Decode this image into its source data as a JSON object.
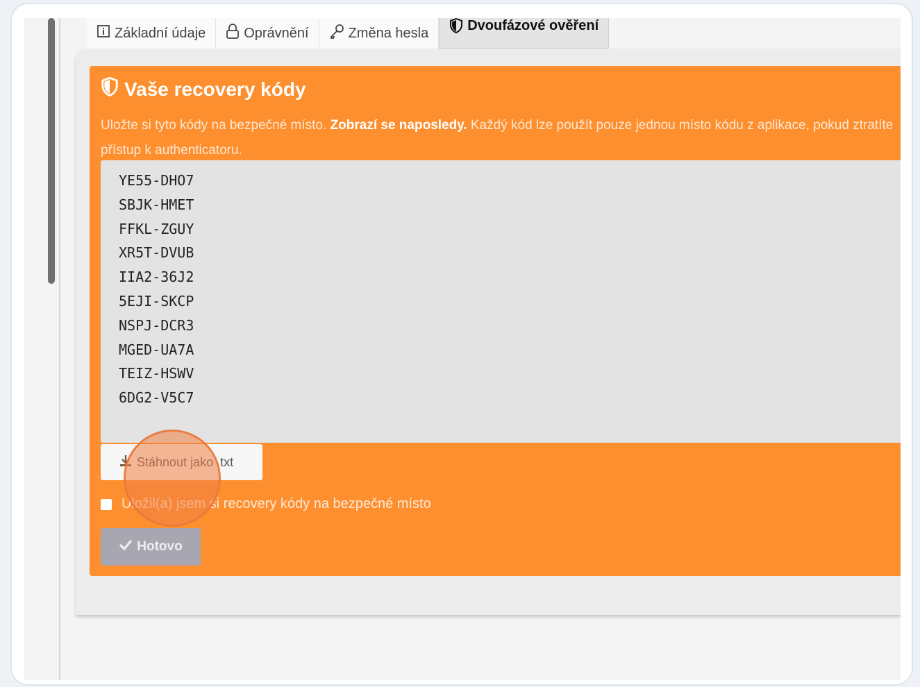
{
  "tabs": [
    {
      "label": "Základní údaje",
      "icon": "info-icon"
    },
    {
      "label": "Oprávnění",
      "icon": "lock-icon"
    },
    {
      "label": "Změna hesla",
      "icon": "key-icon"
    },
    {
      "label": "Dvoufázové ověření",
      "icon": "shield-icon",
      "active": true
    }
  ],
  "alert": {
    "title": "Vaše recovery kódy",
    "description_part1": "Uložte si tyto kódy na bezpečné místo. ",
    "description_bold": "Zobrazí se naposledy.",
    "description_part2": " Každý kód lze použít pouze jednou místo kódu z aplikace, pokud ztratíte přístup k authenticatoru.",
    "color": "#fd8f2e"
  },
  "codes": [
    "YE55-DHO7",
    "SBJK-HMET",
    "FFKL-ZGUY",
    "XR5T-DVUB",
    "IIA2-36J2",
    "5EJI-SKCP",
    "NSPJ-DCR3",
    "MGED-UA7A",
    "TEIZ-HSWV",
    "6DG2-V5C7"
  ],
  "download": {
    "label": "Stáhnout jako .txt",
    "icon": "download-icon"
  },
  "confirm": {
    "label": "Uložil(a) jsem si recovery kódy na bezpečné místo",
    "checked": false
  },
  "done": {
    "label": "Hotovo",
    "icon": "check-icon"
  }
}
